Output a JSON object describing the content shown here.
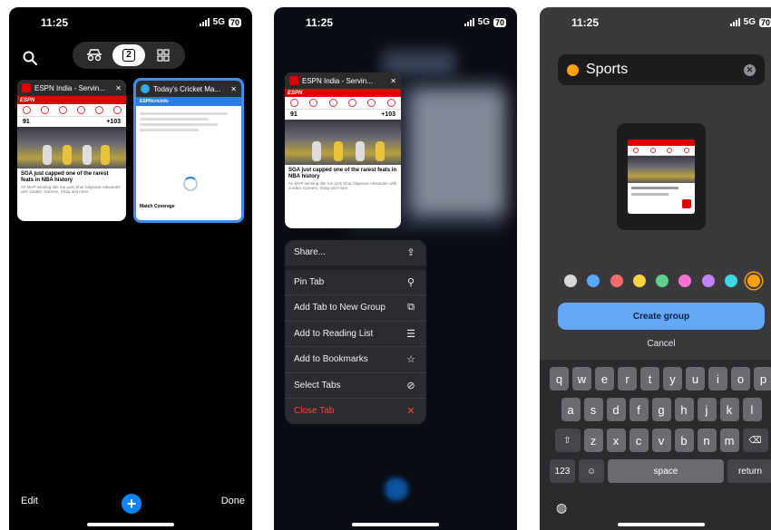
{
  "status": {
    "time": "11:25",
    "network": "5G",
    "battery": "70"
  },
  "panel1": {
    "toolbar": {
      "private_label": "Private",
      "count": "2",
      "grid_label": "Tab Groups"
    },
    "tabs": [
      {
        "title": "ESPN India - Servin...",
        "brand": "ESPN",
        "score_left": "91",
        "score_right": "+103",
        "headline": "SGA just capped one of the rarest feats in NBA history",
        "summary": "An MVP-winning title run puts Shai Gilgeous-Alexander with Jordan, Kareem, Shaq and more."
      },
      {
        "title": "Today's Cricket Ma...",
        "site": "ESPNcricinfo",
        "footer": "Match Coverage"
      }
    ],
    "edit": "Edit",
    "add": "+",
    "done": "Done"
  },
  "panel2": {
    "tab_title": "ESPN India - Servin...",
    "menu": [
      {
        "label": "Share...",
        "icon": "share-icon",
        "glyph": "⇪"
      },
      {
        "label": "Pin Tab",
        "icon": "pin-icon",
        "glyph": "⚲"
      },
      {
        "label": "Add Tab to New Group",
        "icon": "add-to-group-icon",
        "glyph": "⧉"
      },
      {
        "label": "Add to Reading List",
        "icon": "reading-list-icon",
        "glyph": "☰"
      },
      {
        "label": "Add to Bookmarks",
        "icon": "star-icon",
        "glyph": "☆"
      },
      {
        "label": "Select Tabs",
        "icon": "select-check-icon",
        "glyph": "⊘"
      },
      {
        "label": "Close Tab",
        "icon": "close-icon",
        "glyph": "✕"
      }
    ],
    "danger_color": "#ff453a"
  },
  "panel3": {
    "group_name": "Sports",
    "create": "Create group",
    "cancel": "Cancel",
    "swatches": [
      "#d9d9d9",
      "#5aa9ff",
      "#ff6b6b",
      "#ffd23f",
      "#5fd08a",
      "#ff6fd0",
      "#c182ff",
      "#3fd6e8",
      "#ff9f0a"
    ],
    "selected_swatch": "#ff9f0a",
    "keyboard": {
      "row1": [
        "q",
        "w",
        "e",
        "r",
        "t",
        "y",
        "u",
        "i",
        "o",
        "p"
      ],
      "row2": [
        "a",
        "s",
        "d",
        "f",
        "g",
        "h",
        "j",
        "k",
        "l"
      ],
      "row3": [
        "z",
        "x",
        "c",
        "v",
        "b",
        "n",
        "m"
      ],
      "num": "123",
      "space": "space",
      "return": "return"
    }
  }
}
